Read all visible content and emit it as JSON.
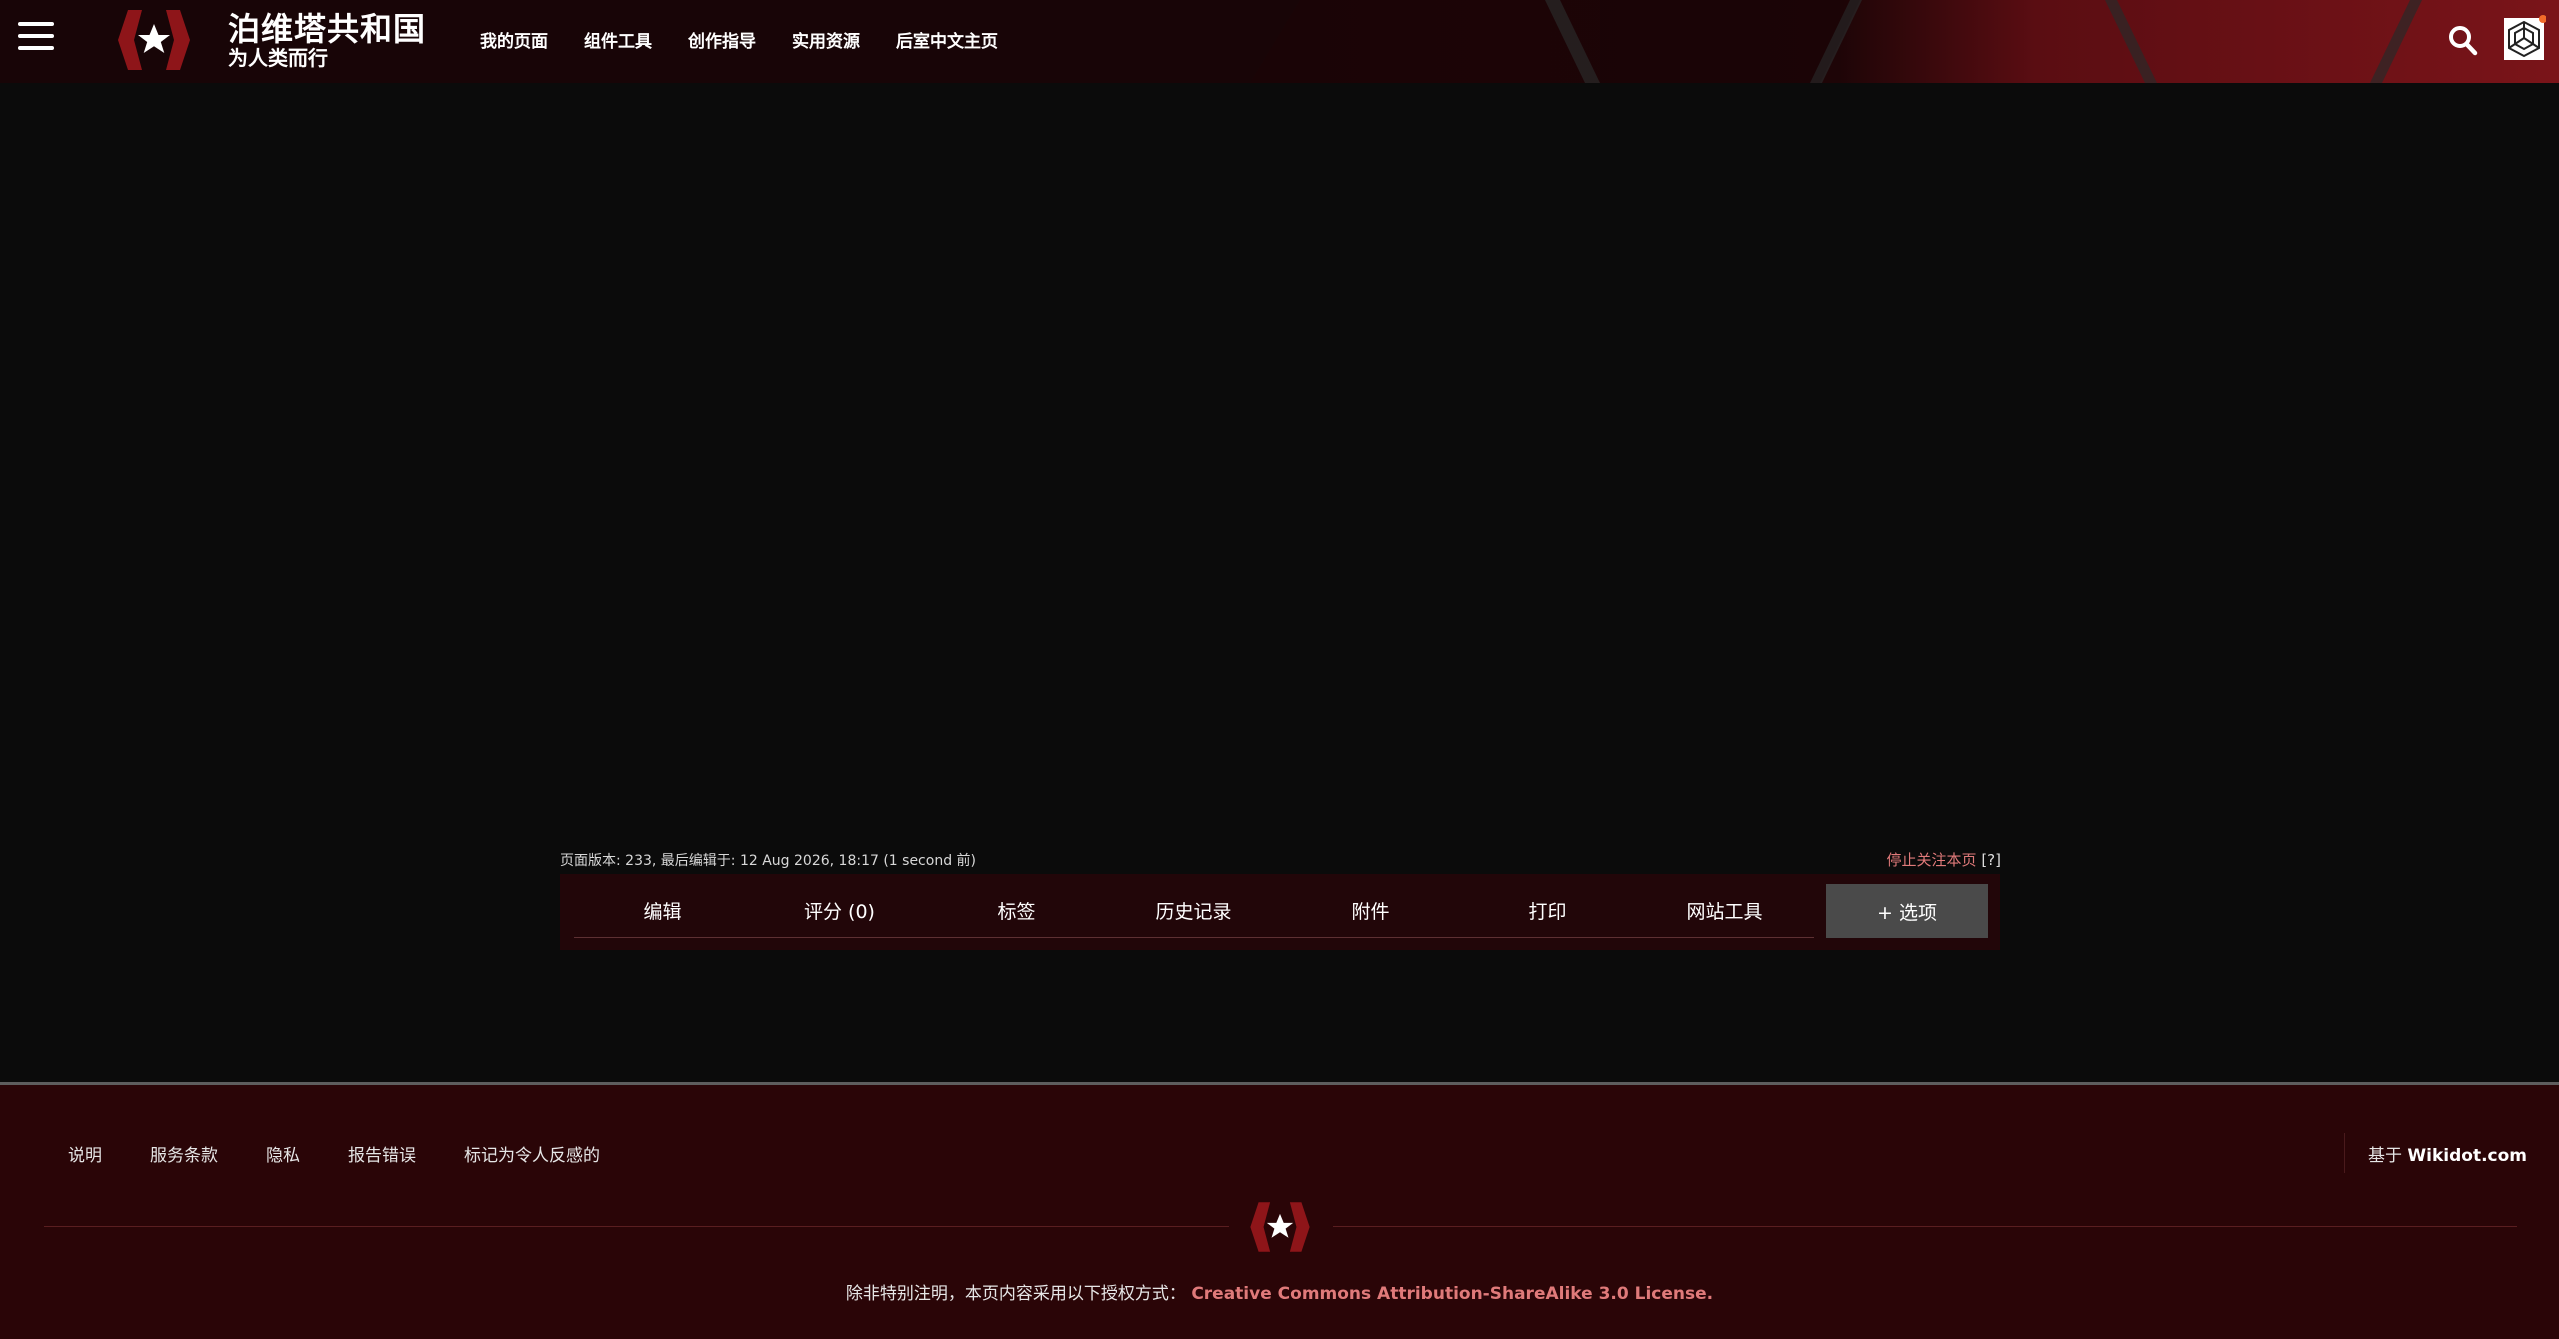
{
  "header": {
    "site_title": "泊维塔共和国",
    "site_subtitle": "为人类而行",
    "nav": [
      "我的页面",
      "组件工具",
      "创作指导",
      "实用资源",
      "后室中文主页"
    ]
  },
  "page_meta": {
    "info": "页面版本: 233, 最后编辑于: 12 Aug 2026, 18:17 (1 second 前)",
    "unwatch": "停止关注本页",
    "help": "[?]"
  },
  "toolbar": {
    "tabs": [
      "编辑",
      "评分 (0)",
      "标签",
      "历史记录",
      "附件",
      "打印",
      "网站工具"
    ],
    "options": "+ 选项"
  },
  "footer": {
    "links": [
      "说明",
      "服务条款",
      "隐私",
      "报告错误",
      "标记为令人反感的"
    ],
    "powered_prefix": "基于",
    "powered_link": "Wikidot.com",
    "license_prefix": "除非特别注明，本页内容采用以下授权方式：",
    "license_link": "Creative Commons Attribution-ShareAlike 3.0 License."
  },
  "colors": {
    "accent": "#a11a1f",
    "link": "#e07a7a",
    "header_bg": "#180507",
    "footer_bg": "#2a0507"
  },
  "icons": [
    "menu-icon",
    "logo-icon",
    "search-icon",
    "avatar-icon"
  ]
}
